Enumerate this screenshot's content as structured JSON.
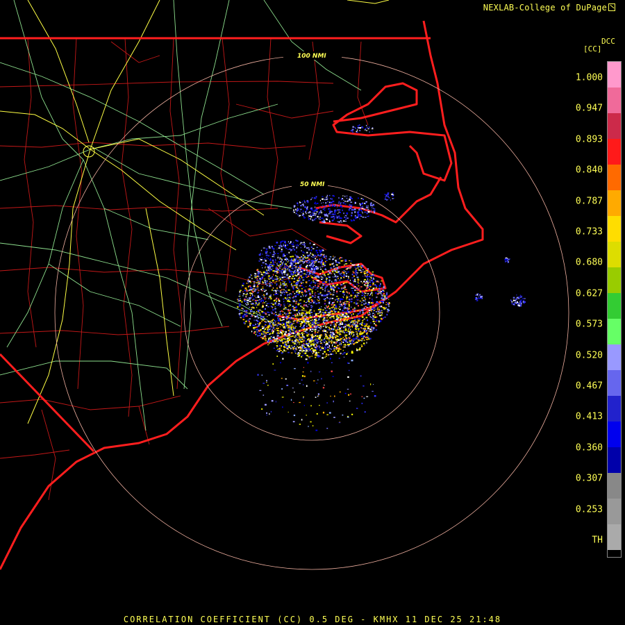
{
  "header": {
    "credit": "NEXLAB-College of DuPage",
    "credit_icon": "launch-icon"
  },
  "legend": {
    "product_label": "DCC",
    "unit_label": "[CC]",
    "ticks": [
      "1.000",
      "0.947",
      "0.893",
      "0.840",
      "0.787",
      "0.733",
      "0.680",
      "0.627",
      "0.573",
      "0.520",
      "0.467",
      "0.413",
      "0.360",
      "0.307",
      "0.253",
      "TH"
    ],
    "colors": [
      "#ff99cc",
      "#f06a9a",
      "#cc2a4a",
      "#ff1a1a",
      "#ff6a00",
      "#ffaa00",
      "#ffdd00",
      "#dddd00",
      "#99cc00",
      "#33cc33",
      "#66ff66",
      "#9999ff",
      "#6666ee",
      "#2222cc",
      "#0000ee",
      "#0000aa",
      "#888888",
      "#999999",
      "#aaaaaa"
    ]
  },
  "map": {
    "range_rings": [
      "100 NMI",
      "50 NMI"
    ],
    "radar_site": "KMHX",
    "colors": {
      "state_border": "#ff2020",
      "county_border": "#cc1a1a",
      "roads_major": "#ffff44",
      "roads_minor": "#99ee99",
      "range_ring": "#f0b0a0"
    }
  },
  "footer": {
    "caption": "CORRELATION COEFFICIENT (CC) 0.5 DEG - KMHX 11 DEC 25 21:48"
  }
}
